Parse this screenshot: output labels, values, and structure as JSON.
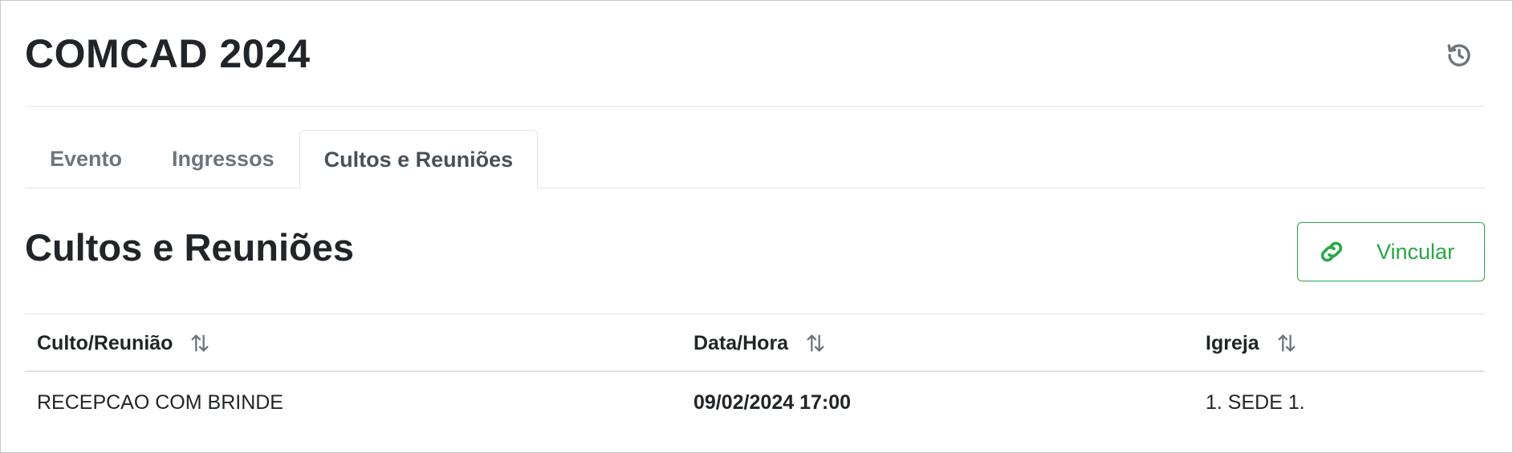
{
  "header": {
    "title": "COMCAD 2024"
  },
  "tabs": [
    {
      "label": "Evento",
      "active": false
    },
    {
      "label": "Ingressos",
      "active": false
    },
    {
      "label": "Cultos e Reuniões",
      "active": true
    }
  ],
  "section": {
    "title": "Cultos e Reuniões",
    "link_button_label": "Vincular",
    "link_button_color": "#28a745"
  },
  "table": {
    "columns": [
      "Culto/Reunião",
      "Data/Hora",
      "Igreja"
    ],
    "rows": [
      [
        "RECEPCAO COM BRINDE",
        "09/02/2024 17:00",
        "1. SEDE 1."
      ]
    ]
  },
  "icons": {
    "history": "history-icon",
    "link": "link-icon",
    "sort": "sort-arrows-icon"
  }
}
